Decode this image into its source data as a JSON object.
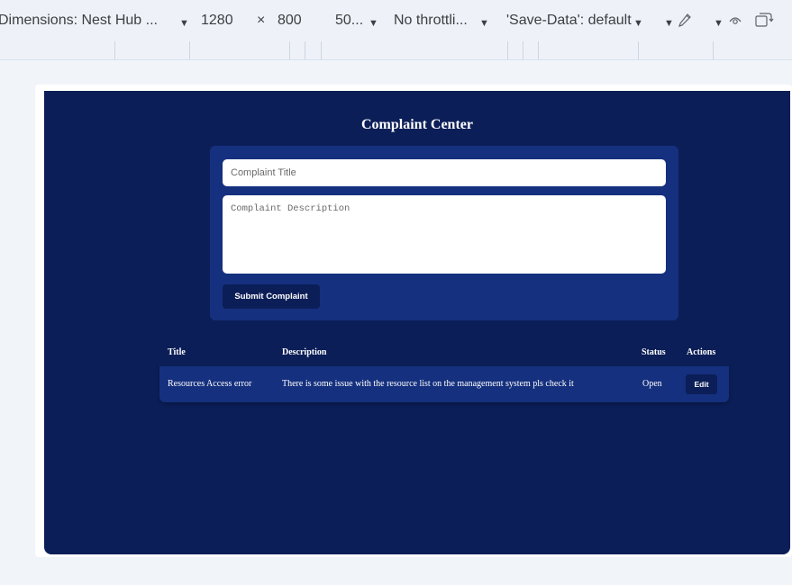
{
  "devtools": {
    "dimensions_label": "Dimensions: Nest Hub ...",
    "width": "1280",
    "times": "×",
    "height": "800",
    "zoom": "50...",
    "throttling": "No throttli...",
    "save_data": "'Save-Data': default",
    "icons": [
      "caret-down-icon",
      "eyedropper-icon",
      "eye-icon",
      "rotate-device-icon"
    ]
  },
  "app": {
    "title": "Complaint Center",
    "form": {
      "title_placeholder": "Complaint Title",
      "description_placeholder": "Complaint Description",
      "submit_label": "Submit Complaint"
    },
    "table": {
      "columns": [
        "Title",
        "Description",
        "Status",
        "Actions"
      ],
      "rows": [
        {
          "title": "Resources Access error",
          "description": "There is some issue with the resource list on the management system pls check it",
          "status": "Open",
          "action_label": "Edit"
        }
      ]
    }
  },
  "colors": {
    "app_background": "#0b1e57",
    "card_background": "#15307e",
    "toolbar_background": "#eef2f8"
  }
}
